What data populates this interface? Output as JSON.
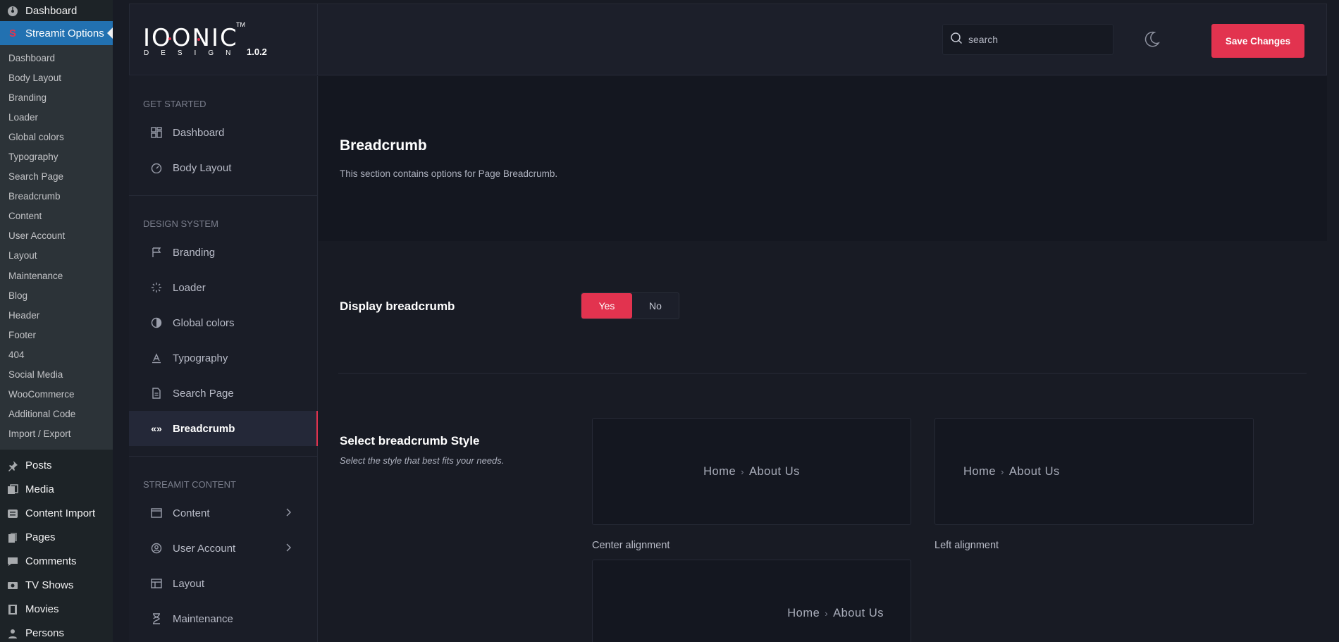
{
  "wp_menu": {
    "dashboard": "Dashboard",
    "current": "Streamit Options",
    "sub_items": [
      "Dashboard",
      "Body Layout",
      "Branding",
      "Loader",
      "Global colors",
      "Typography",
      "Search Page",
      "Breadcrumb",
      "Content",
      "User Account",
      "Layout",
      "Maintenance",
      "Blog",
      "Header",
      "Footer",
      "404",
      "Social Media",
      "WooCommerce",
      "Additional Code",
      "Import / Export"
    ],
    "bottom_items": [
      "Posts",
      "Media",
      "Content Import",
      "Pages",
      "Comments",
      "TV Shows",
      "Movies",
      "Persons"
    ]
  },
  "header": {
    "logo_word": "IOONIC",
    "logo_sub": "DESIGN",
    "logo_tm": "TM",
    "version": "1.0.2",
    "search_placeholder": "search",
    "save_label": "Save Changes"
  },
  "nav": {
    "sections": [
      {
        "title": "GET STARTED",
        "items": [
          "Dashboard",
          "Body Layout"
        ]
      },
      {
        "title": "DESIGN SYSTEM",
        "items": [
          "Branding",
          "Loader",
          "Global colors",
          "Typography",
          "Search Page",
          "Breadcrumb"
        ]
      },
      {
        "title": "STREAMIT CONTENT",
        "items": [
          "Content",
          "User Account",
          "Layout",
          "Maintenance"
        ]
      }
    ],
    "active": "Breadcrumb"
  },
  "page": {
    "title": "Breadcrumb",
    "description": "This section contains options for Page Breadcrumb.",
    "display_label": "Display breadcrumb",
    "toggle_yes": "Yes",
    "toggle_no": "No",
    "style_label": "Select breadcrumb Style",
    "style_desc": "Select the style that best fits your needs.",
    "crumb_home": "Home",
    "crumb_current": "About Us",
    "styles": [
      "Center alignment",
      "Left alignment",
      ""
    ]
  },
  "colors": {
    "accent": "#e2334f",
    "wp_highlight": "#2271b1"
  }
}
